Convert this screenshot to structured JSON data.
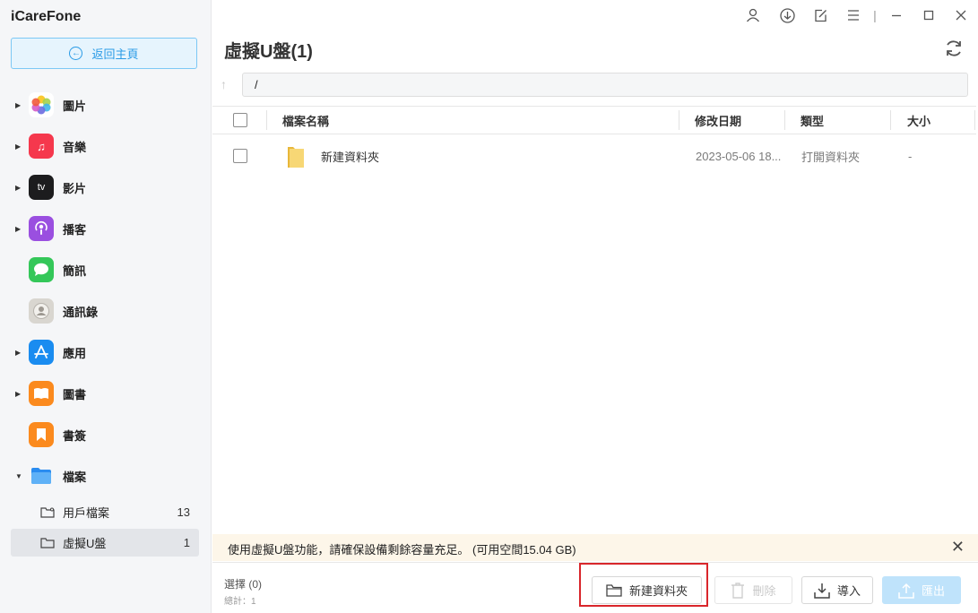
{
  "app": {
    "title": "iCareFone"
  },
  "sidebar": {
    "back_label": "返回主頁",
    "items": [
      {
        "label": "圖片",
        "icon": "photos-icon",
        "color": "#ffffff"
      },
      {
        "label": "音樂",
        "icon": "music-icon",
        "color": "#f5384d"
      },
      {
        "label": "影片",
        "icon": "tv-icon",
        "color": "#1c1c1e"
      },
      {
        "label": "播客",
        "icon": "podcast-icon",
        "color": "#9a4fe0"
      },
      {
        "label": "簡訊",
        "icon": "messages-icon",
        "color": "#34c759"
      },
      {
        "label": "通訊錄",
        "icon": "contacts-icon",
        "color": "#d9d6d0"
      },
      {
        "label": "應用",
        "icon": "appstore-icon",
        "color": "#1a8cf0"
      },
      {
        "label": "圖書",
        "icon": "books-icon",
        "color": "#fb8a1e"
      },
      {
        "label": "書簽",
        "icon": "bookmark-icon",
        "color": "#fb8a1e"
      },
      {
        "label": "檔案",
        "icon": "files-icon",
        "color": "#2a8cf0"
      }
    ],
    "sub_items": [
      {
        "label": "用戶檔案",
        "count": "13"
      },
      {
        "label": "虛擬U盤",
        "count": "1"
      }
    ]
  },
  "header": {
    "title": "虛擬U盤(1)"
  },
  "path": {
    "value": "/"
  },
  "table": {
    "columns": [
      "檔案名稱",
      "修改日期",
      "類型",
      "大小"
    ],
    "rows": [
      {
        "name": "新建資料夾",
        "date": "2023-05-06 18...",
        "type": "打開資料夾",
        "size": "-"
      }
    ]
  },
  "notice": {
    "text": "使用虛擬U盤功能，請確保設備剩餘容量充足。 (可用空間15.04 GB)"
  },
  "footer": {
    "selected": "選擇 (0)",
    "total": "總計：1",
    "new_folder": "新建資料夾",
    "delete": "刪除",
    "import": "導入",
    "export": "匯出"
  },
  "colors": {
    "accent": "#2a9be6",
    "highlight": "#d9262b",
    "notice_bg": "#fdf6e9"
  }
}
